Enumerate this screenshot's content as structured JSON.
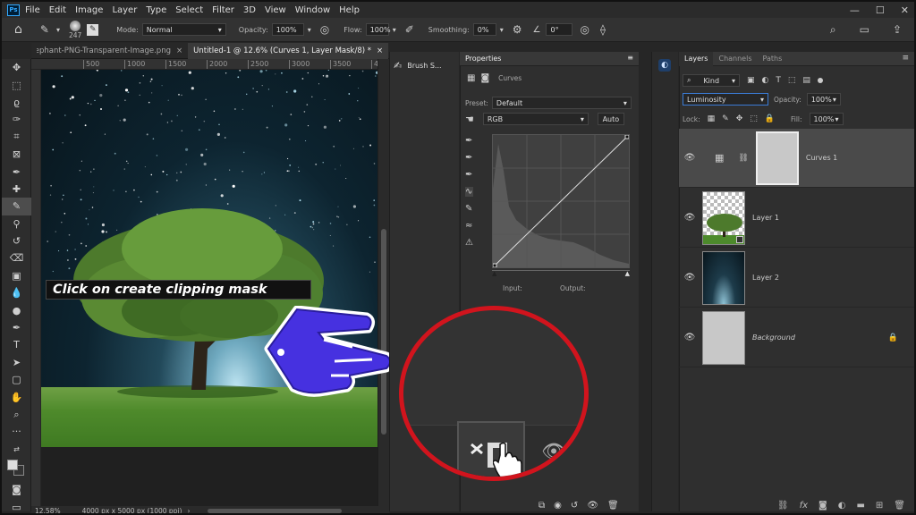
{
  "app": {
    "logo": "Ps"
  },
  "menu": [
    "File",
    "Edit",
    "Image",
    "Layer",
    "Type",
    "Select",
    "Filter",
    "3D",
    "View",
    "Window",
    "Help"
  ],
  "options": {
    "brush_size": "247",
    "mode_label": "Mode:",
    "mode_value": "Normal",
    "opacity_label": "Opacity:",
    "opacity_value": "100%",
    "flow_label": "Flow:",
    "flow_value": "100%",
    "smoothing_label": "Smoothing:",
    "smoothing_value": "0%",
    "angle_value": "0°"
  },
  "tabs": [
    {
      "label": "Elephant-PNG-Transparent-Image.png"
    },
    {
      "label": "Untitled-1 @ 12.6% (Curves 1, Layer Mask/8) *"
    }
  ],
  "ruler_ticks": [
    "500",
    "1000",
    "1500",
    "2000",
    "2500",
    "3000",
    "3500",
    "4000"
  ],
  "status": {
    "zoom": "12.58%",
    "doc_info": "4000 px x 5000 px (1000 ppi)"
  },
  "callout": "Click on create clipping mask",
  "brush_panel": {
    "label": "Brush S..."
  },
  "properties": {
    "title": "Properties",
    "type": "Curves",
    "preset_label": "Preset:",
    "preset_value": "Default",
    "channel": "RGB",
    "auto": "Auto",
    "input_label": "Input:",
    "output_label": "Output:"
  },
  "layers_panel": {
    "tabs": [
      "Layers",
      "Channels",
      "Paths"
    ],
    "kind": "Kind",
    "blend_mode": "Luminosity",
    "opacity_label": "Opacity:",
    "opacity_value": "100%",
    "lock_label": "Lock:",
    "fill_label": "Fill:",
    "fill_value": "100%",
    "layers": [
      {
        "name": "Curves 1"
      },
      {
        "name": "Layer 1"
      },
      {
        "name": "Layer 2"
      },
      {
        "name": "Background"
      }
    ]
  },
  "colors": {
    "accent_red": "#d1141d",
    "hand_blue": "#4631e0",
    "ps_blue": "#31a8ff"
  }
}
